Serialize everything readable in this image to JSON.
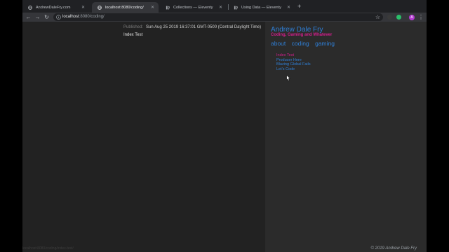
{
  "tabs": [
    {
      "title": "AndrewDaleFry.com",
      "active": false,
      "favicon": "globe-icon"
    },
    {
      "title": "localhost:8080/coding/",
      "active": true,
      "favicon": "globe-icon"
    },
    {
      "title": "Collections — Eleventy",
      "active": false,
      "favicon": "eleventy-icon"
    },
    {
      "title": "Using Data — Eleventy",
      "active": false,
      "favicon": "eleventy-icon"
    }
  ],
  "new_tab_label": "+",
  "toolbar": {
    "url_host": "localhost",
    "url_rest": ":8080/coding/",
    "avatar_letter": "A"
  },
  "article": {
    "published_label": "Published:",
    "published_date": "Sun Aug 25 2019 16:37:01 GMT-0500 (Central Daylight Time)",
    "body": "Index Test"
  },
  "sidebar": {
    "site_title": "Andrew Dale Fry",
    "tagline": "Coding, Gaming and Whatever",
    "nav": [
      "about",
      "coding",
      "gaming"
    ],
    "posts": [
      "Index Test",
      "Producer Here",
      "Blazing Global Fails",
      "Let's Code"
    ]
  },
  "footer": "© 2019 Andrew Dale Fry",
  "status_url": "localhost:8080/coding/index-test/",
  "colors": {
    "link": "#2f7fd6",
    "accent": "#d41f8d",
    "main_bg": "#222222",
    "sidebar_bg": "#2b2b2b"
  }
}
